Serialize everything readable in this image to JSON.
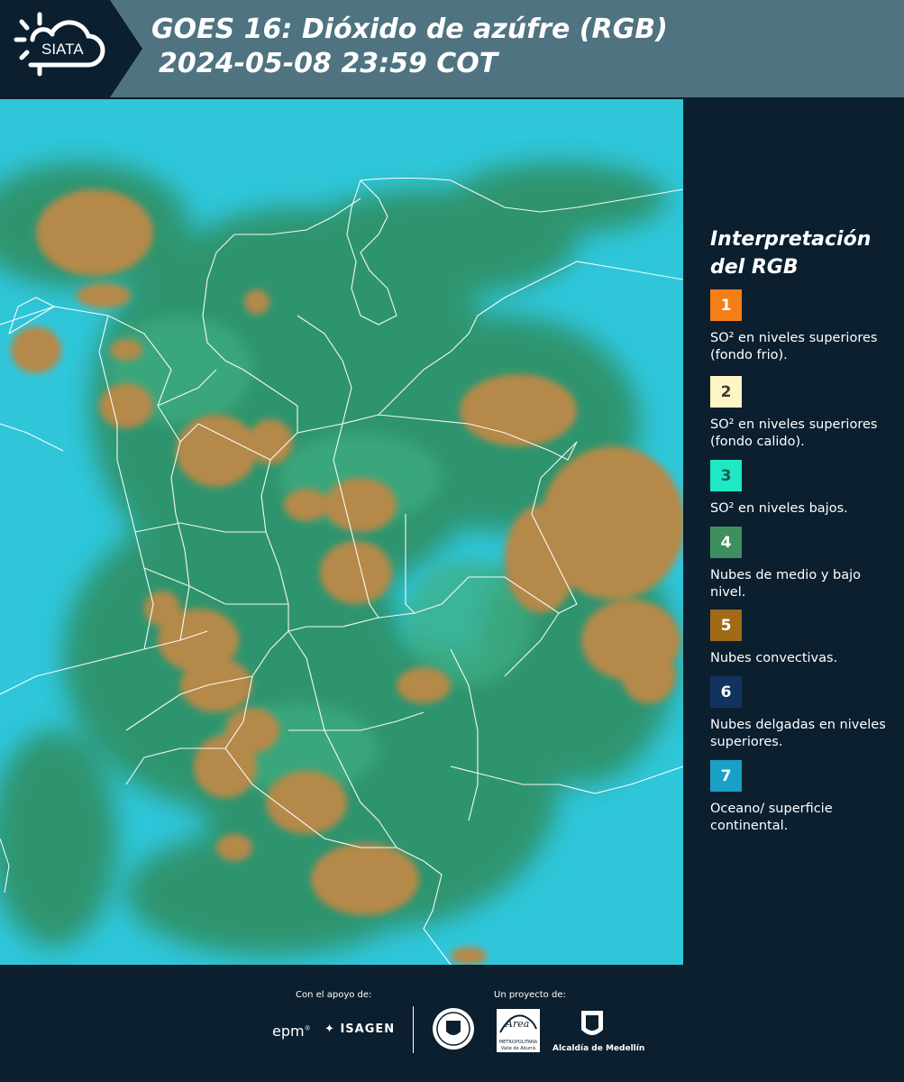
{
  "header": {
    "logo_text": "SIATA",
    "title_line1": "GOES 16: Dióxido de azúfre (RGB)",
    "title_line2": "2024-05-08 23:59 COT"
  },
  "legend": {
    "title_line1": "Interpretación",
    "title_line2": "del RGB",
    "items": [
      {
        "num": "1",
        "color": "#f57f17",
        "num_color": "#ffffff",
        "text": "SO² en niveles superiores (fondo frio)."
      },
      {
        "num": "2",
        "color": "#fff6c4",
        "num_color": "#3a3a3a",
        "text": "SO² en niveles superiores (fondo calido)."
      },
      {
        "num": "3",
        "color": "#1de9c4",
        "num_color": "#1a5a50",
        "text": "SO² en niveles bajos."
      },
      {
        "num": "4",
        "color": "#3d8f5e",
        "num_color": "#ffffff",
        "text": "Nubes de medio y bajo nivel."
      },
      {
        "num": "5",
        "color": "#a06a17",
        "num_color": "#ffffff",
        "text": "Nubes convectivas."
      },
      {
        "num": "6",
        "color": "#12335f",
        "num_color": "#ffffff",
        "text": "Nubes delgadas en niveles superiores."
      },
      {
        "num": "7",
        "color": "#1aa0c6",
        "num_color": "#ffffff",
        "text": "Oceano/ superficie continental."
      }
    ]
  },
  "footer": {
    "support_label": "Con el apoyo de:",
    "project_label": "Un proyecto de:",
    "epm": "epm",
    "isagen": "ISAGEN",
    "area_name": "METROPOLITANA",
    "area_sub": "Valle de Aburrá",
    "alcaldia": "Alcaldía de Medellín"
  },
  "colors": {
    "ocean": "#2fc6da",
    "land_green": "#2f8f63",
    "convective": "#b5894a",
    "border": "#ffffff",
    "background": "#0b1f2e"
  }
}
